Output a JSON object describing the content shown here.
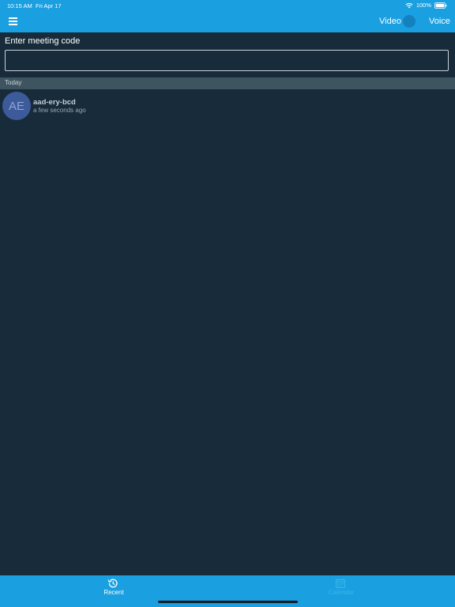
{
  "status_bar": {
    "time": "10:15 AM",
    "date": "Fri Apr 17",
    "battery": "100%"
  },
  "header": {
    "menu_icon": "hamburger-menu-icon",
    "mode_left": "Video",
    "mode_right": "Voice"
  },
  "meeting": {
    "label": "Enter meeting code",
    "value": ""
  },
  "recent": {
    "section_title": "Today",
    "items": [
      {
        "initials": "AE",
        "code": "aad-ery-bcd",
        "time": "a few seconds ago"
      }
    ]
  },
  "tabs": [
    {
      "label": "Recent",
      "icon": "history-icon"
    },
    {
      "label": "Calendar",
      "icon": "calendar-icon"
    }
  ],
  "colors": {
    "primary": "#1a9fe0",
    "background": "#172b3a",
    "section": "#3e5560",
    "avatar": "#3d5a9a"
  }
}
